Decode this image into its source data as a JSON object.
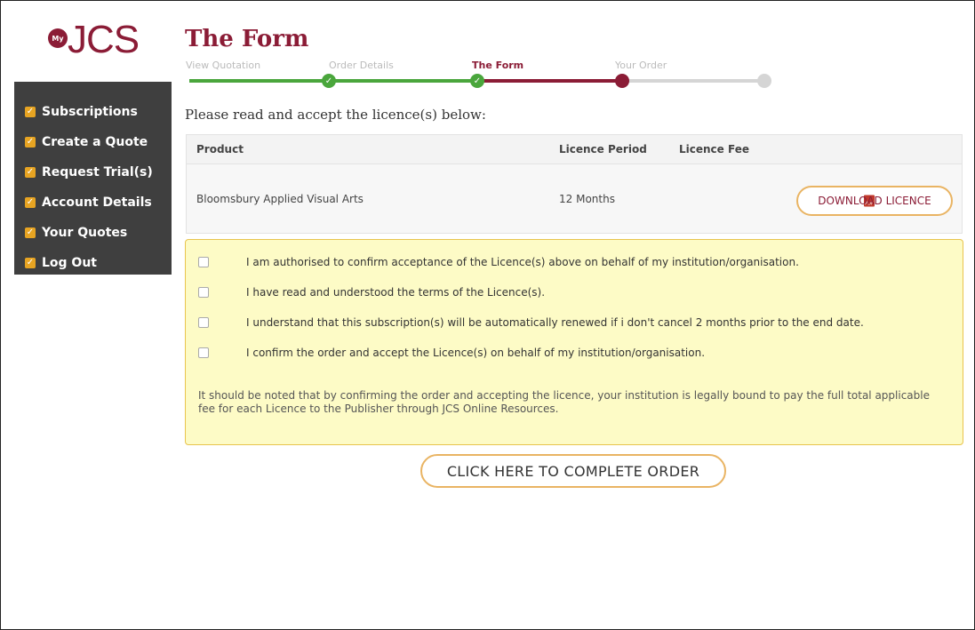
{
  "logo": {
    "badge": "My",
    "text": "JCS"
  },
  "sidebar": {
    "items": [
      {
        "label": "Subscriptions"
      },
      {
        "label": "Create a Quote"
      },
      {
        "label": "Request Trial(s)"
      },
      {
        "label": "Account Details"
      },
      {
        "label": "Your Quotes"
      },
      {
        "label": "Log Out"
      }
    ]
  },
  "page": {
    "title": "The Form",
    "instructions": "Please read and accept the licence(s) below:"
  },
  "steps": [
    {
      "label": "View Quotation",
      "state": "done"
    },
    {
      "label": "Order Details",
      "state": "done"
    },
    {
      "label": "The Form",
      "state": "active"
    },
    {
      "label": "Your Order",
      "state": "pending"
    }
  ],
  "colors": {
    "brand": "#8b1c36",
    "done": "#4aa63c",
    "pending": "#d5d5d5",
    "accent": "#e7a422"
  },
  "table": {
    "headers": {
      "product": "Product",
      "period": "Licence Period",
      "fee": "Licence Fee"
    },
    "rows": [
      {
        "product": "Bloomsbury Applied Visual Arts",
        "period": "12 Months",
        "fee": "",
        "download_label": "DOWNLOAD LICENCE"
      }
    ]
  },
  "consent": {
    "items": [
      {
        "label": "I am authorised to confirm acceptance of the Licence(s) above on behalf of my institution/organisation."
      },
      {
        "label": "I have read and understood the terms of the Licence(s)."
      },
      {
        "label": "I understand that this subscription(s) will be automatically renewed if i don't cancel 2 months prior to the end date."
      },
      {
        "label": "I confirm the order and accept the Licence(s) on behalf of my institution/organisation."
      }
    ],
    "notice": "It should be noted that by confirming the order and accepting the licence, your institution is legally bound to pay the full total applicable fee for each Licence to the Publisher through JCS Online Resources."
  },
  "actions": {
    "complete_label": "CLICK HERE TO COMPLETE ORDER"
  }
}
